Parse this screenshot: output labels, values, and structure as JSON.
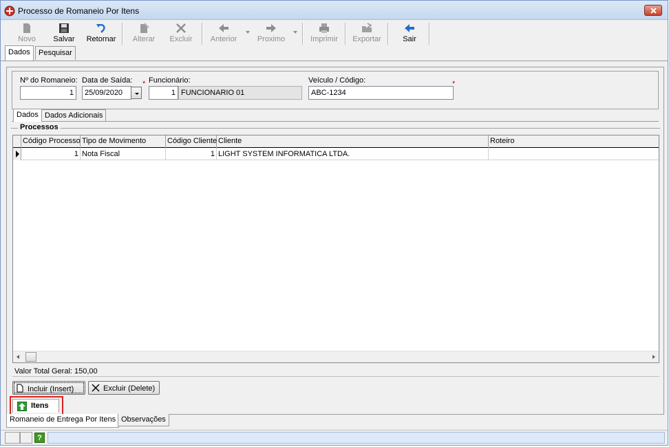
{
  "window": {
    "title": "Processo de Romaneio Por Itens"
  },
  "toolbar": {
    "novo": "Novo",
    "salvar": "Salvar",
    "retornar": "Retornar",
    "alterar": "Alterar",
    "excluir": "Excluir",
    "anterior": "Anterior",
    "proximo": "Proximo",
    "imprimir": "Imprimir",
    "exportar": "Exportar",
    "sair": "Sair"
  },
  "top_tabs": [
    "Dados",
    "Pesquisar"
  ],
  "header": {
    "romaneio_label": "Nº do Romaneio:",
    "romaneio_value": "1",
    "data_label": "Data de Saída:",
    "data_value": "25/09/2020",
    "funcionario_label": "Funcionário:",
    "funcionario_code": "1",
    "funcionario_name": "FUNCIONARIO 01",
    "veiculo_label": "Veículo / Código:",
    "veiculo_value": "ABC-1234",
    "required_mark": "*"
  },
  "inner_tabs": [
    "Dados",
    "Dados Adicionais"
  ],
  "processos": {
    "title": "Processos",
    "columns": [
      "Código Processo",
      "Tipo de Movimento",
      "Código Cliente",
      "Cliente",
      "Roteiro"
    ],
    "rows": [
      {
        "codigo_processo": "1",
        "tipo_movimento": "Nota Fiscal",
        "codigo_cliente": "1",
        "cliente": "LIGHT SYSTEM INFORMATICA LTDA.",
        "roteiro": ""
      }
    ],
    "total_label": "Valor Total Geral: 150,00"
  },
  "actions": {
    "incluir": "Incluir (Insert)",
    "excluir": "Excluir (Delete)"
  },
  "itens_tab": "Itens",
  "bottom_tabs": [
    "Romaneio de Entrega Por Itens",
    "Observações"
  ],
  "status": {
    "help": "?"
  },
  "colors": {
    "title_bg": "#c5d7ee",
    "required": "#d00000",
    "highlight_border": "#e02020",
    "help_green": "#3e9a1f"
  }
}
